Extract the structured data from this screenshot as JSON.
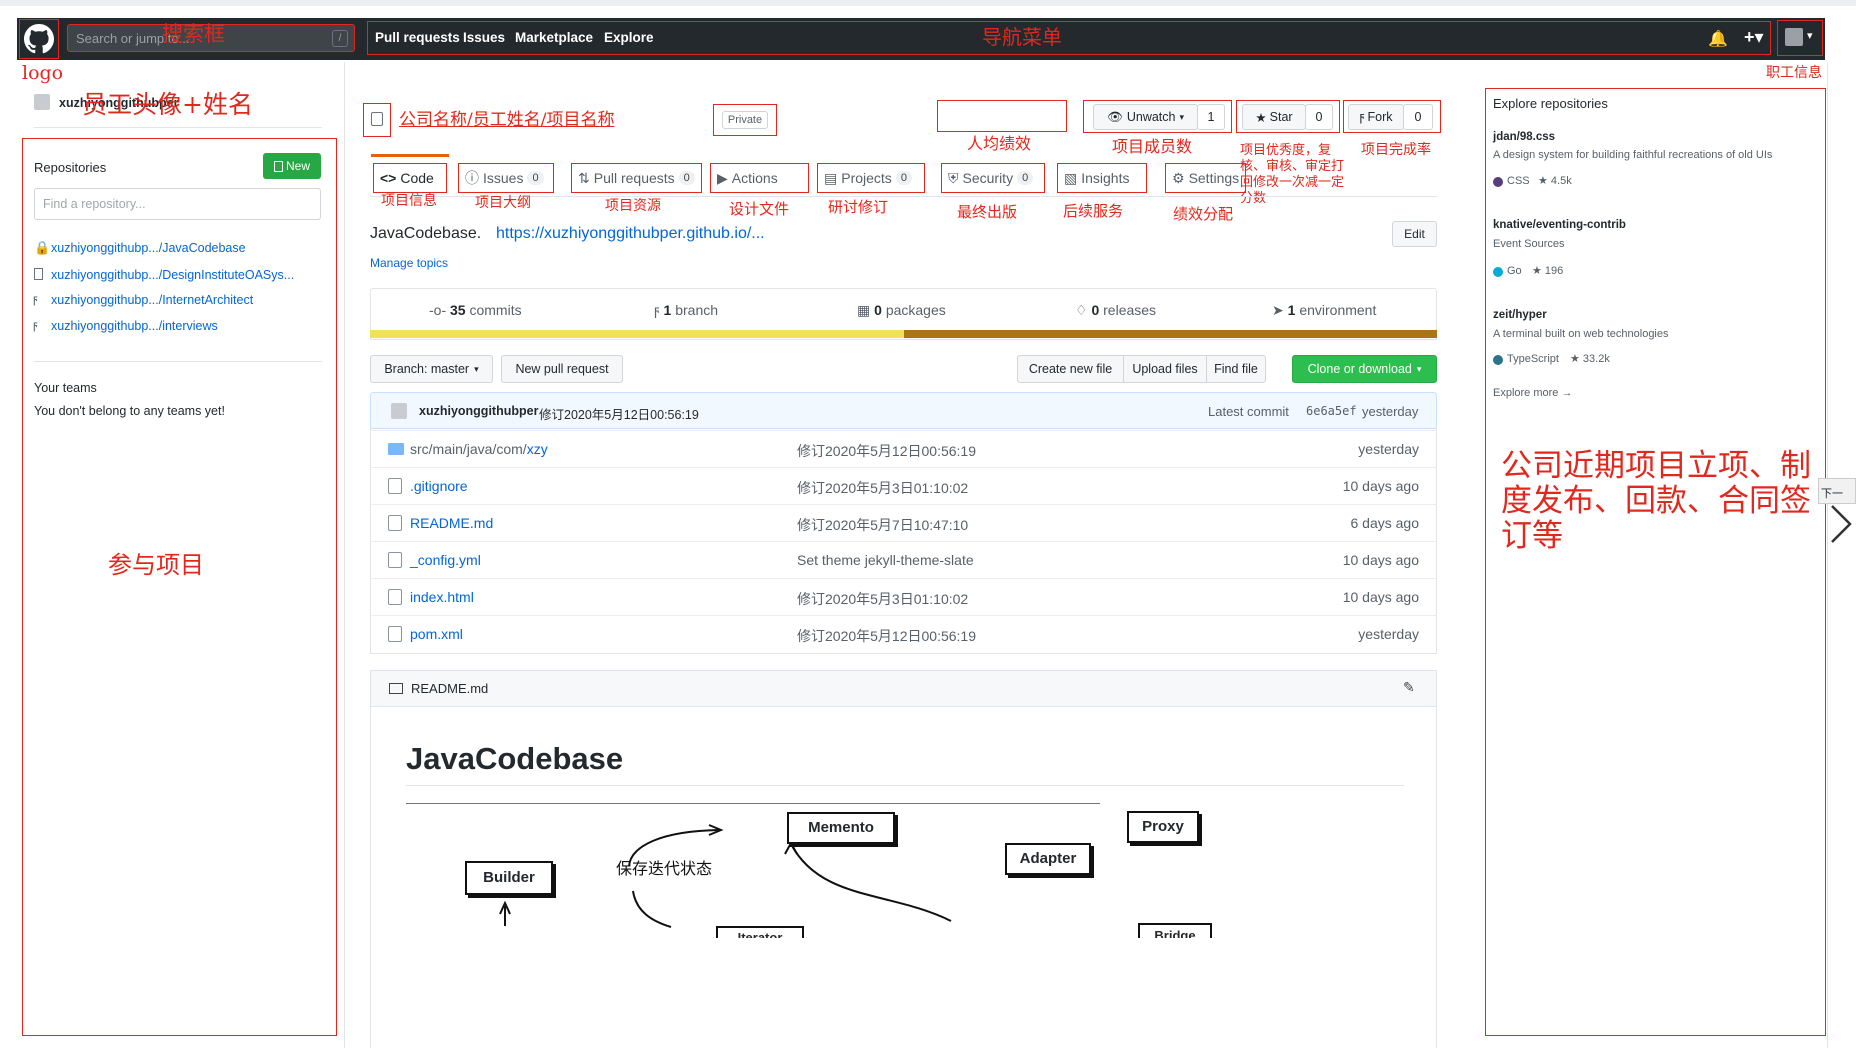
{
  "header": {
    "search_placeholder": "Search or jump to...",
    "slash_key": "/",
    "nav": [
      "Pull requests",
      "Issues",
      "Marketplace",
      "Explore"
    ]
  },
  "annotations": {
    "search": "搜索框",
    "nav_menu": "导航菜单",
    "logo": "logo",
    "employee_info": "职工信息",
    "avatar_name": "员工头像+姓名",
    "repo_title": "公司名称/员工姓名/项目名称",
    "avg_perf": "人均绩效",
    "members": "项目成员数",
    "excellence": "项目优秀度，复核、审核、审定打回修改一次减一定分数",
    "completion": "项目完成率",
    "code": "项目信息",
    "issues": "项目大纲",
    "pulls": "项目资源",
    "actions": "设计文件",
    "projects": "研讨修订",
    "security": "最终出版",
    "insights": "后续服务",
    "settings": "绩效分配",
    "participate": "参与项目",
    "company_news": "公司近期项目立项、制度发布、回款、合同签订等"
  },
  "user": {
    "name": "xuzhiyonggithubper"
  },
  "sidebar": {
    "repos_title": "Repositories",
    "new_button": "New",
    "find_placeholder": "Find a repository...",
    "repos": [
      "xuzhiyonggithubp.../JavaCodebase",
      "xuzhiyonggithubp.../DesignInstituteOASys...",
      "xuzhiyonggithubp.../InternetArchitect",
      "xuzhiyonggithubp.../interviews"
    ],
    "teams_title": "Your teams",
    "teams_empty": "You don't belong to any teams yet!"
  },
  "repo": {
    "private_label": "Private",
    "unwatch": "Unwatch",
    "watch_count": "1",
    "star": "Star",
    "star_count": "0",
    "fork": "Fork",
    "fork_count": "0",
    "tabs": [
      {
        "label": "Code",
        "count": ""
      },
      {
        "label": "Issues",
        "count": "0"
      },
      {
        "label": "Pull requests",
        "count": "0"
      },
      {
        "label": "Actions",
        "count": ""
      },
      {
        "label": "Projects",
        "count": "0"
      },
      {
        "label": "Security",
        "count": "0"
      },
      {
        "label": "Insights",
        "count": ""
      },
      {
        "label": "Settings",
        "count": ""
      }
    ],
    "description": "JavaCodebase.",
    "url": "https://xuzhiyonggithubper.github.io/...",
    "edit": "Edit",
    "manage_topics": "Manage topics",
    "stats": {
      "commits_num": "35",
      "commits": "commits",
      "branch_num": "1",
      "branch": "branch",
      "packages_num": "0",
      "packages": "packages",
      "releases_num": "0",
      "releases": "releases",
      "env_num": "1",
      "env": "environment"
    },
    "lang_colors": [
      "#f1e05a",
      "#b07219"
    ],
    "lang_fraction_first": 0.5,
    "branch_button": "Branch: master",
    "new_pr": "New pull request",
    "create_file": "Create new file",
    "upload_files": "Upload files",
    "find_file": "Find file",
    "clone": "Clone or download",
    "latest_user": "xuzhiyonggithubper",
    "latest_msg": "修订2020年5月12日00:56:19",
    "latest_label": "Latest commit",
    "latest_sha": "6e6a5ef",
    "latest_time": "yesterday",
    "files": [
      {
        "name_prefix": "src/main/java/com/",
        "name": "xzy",
        "msg": "修订2020年5月12日00:56:19",
        "time": "yesterday"
      },
      {
        "name_prefix": "",
        "name": ".gitignore",
        "msg": "修订2020年5月3日01:10:02",
        "time": "10 days ago"
      },
      {
        "name_prefix": "",
        "name": "README.md",
        "msg": "修订2020年5月7日10:47:10",
        "time": "6 days ago"
      },
      {
        "name_prefix": "",
        "name": "_config.yml",
        "msg": "Set theme jekyll-theme-slate",
        "time": "10 days ago"
      },
      {
        "name_prefix": "",
        "name": "index.html",
        "msg": "修订2020年5月3日01:10:02",
        "time": "10 days ago"
      },
      {
        "name_prefix": "",
        "name": "pom.xml",
        "msg": "修订2020年5月12日00:56:19",
        "time": "yesterday"
      }
    ],
    "readme_title": "README.md",
    "readme_heading": "JavaCodebase",
    "diagram": {
      "memento": "Memento",
      "proxy": "Proxy",
      "adapter": "Adapter",
      "builder": "Builder",
      "caption": "保存迭代状态",
      "iterator": "Iterator",
      "bridge": "Bridge"
    }
  },
  "explore": {
    "title": "Explore repositories",
    "repos": [
      {
        "name": "jdan/98.css",
        "desc": "A design system for building faithful recreations of old UIs",
        "lang": "CSS",
        "color": "#563d7c",
        "stars": "4.5k"
      },
      {
        "name": "knative/eventing-contrib",
        "desc": "Event Sources",
        "lang": "Go",
        "color": "#00add8",
        "stars": "196"
      },
      {
        "name": "zeit/hyper",
        "desc": "A terminal built on web technologies",
        "lang": "TypeScript",
        "color": "#2b7489",
        "stars": "33.2k"
      }
    ],
    "more": "Explore more →"
  },
  "edge": {
    "next_label": "下一"
  }
}
